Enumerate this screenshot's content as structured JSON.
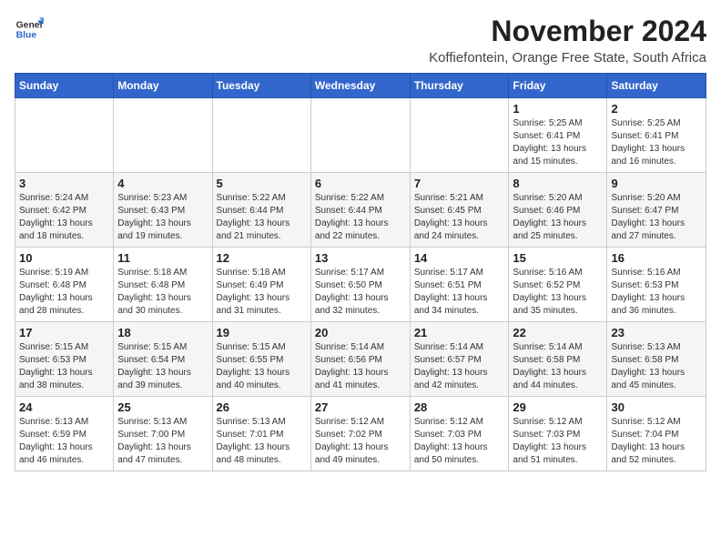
{
  "logo": {
    "line1": "General",
    "line2": "Blue"
  },
  "title": "November 2024",
  "subtitle": "Koffiefontein, Orange Free State, South Africa",
  "weekdays": [
    "Sunday",
    "Monday",
    "Tuesday",
    "Wednesday",
    "Thursday",
    "Friday",
    "Saturday"
  ],
  "weeks": [
    [
      {
        "day": "",
        "info": ""
      },
      {
        "day": "",
        "info": ""
      },
      {
        "day": "",
        "info": ""
      },
      {
        "day": "",
        "info": ""
      },
      {
        "day": "",
        "info": ""
      },
      {
        "day": "1",
        "info": "Sunrise: 5:25 AM\nSunset: 6:41 PM\nDaylight: 13 hours and 15 minutes."
      },
      {
        "day": "2",
        "info": "Sunrise: 5:25 AM\nSunset: 6:41 PM\nDaylight: 13 hours and 16 minutes."
      }
    ],
    [
      {
        "day": "3",
        "info": "Sunrise: 5:24 AM\nSunset: 6:42 PM\nDaylight: 13 hours and 18 minutes."
      },
      {
        "day": "4",
        "info": "Sunrise: 5:23 AM\nSunset: 6:43 PM\nDaylight: 13 hours and 19 minutes."
      },
      {
        "day": "5",
        "info": "Sunrise: 5:22 AM\nSunset: 6:44 PM\nDaylight: 13 hours and 21 minutes."
      },
      {
        "day": "6",
        "info": "Sunrise: 5:22 AM\nSunset: 6:44 PM\nDaylight: 13 hours and 22 minutes."
      },
      {
        "day": "7",
        "info": "Sunrise: 5:21 AM\nSunset: 6:45 PM\nDaylight: 13 hours and 24 minutes."
      },
      {
        "day": "8",
        "info": "Sunrise: 5:20 AM\nSunset: 6:46 PM\nDaylight: 13 hours and 25 minutes."
      },
      {
        "day": "9",
        "info": "Sunrise: 5:20 AM\nSunset: 6:47 PM\nDaylight: 13 hours and 27 minutes."
      }
    ],
    [
      {
        "day": "10",
        "info": "Sunrise: 5:19 AM\nSunset: 6:48 PM\nDaylight: 13 hours and 28 minutes."
      },
      {
        "day": "11",
        "info": "Sunrise: 5:18 AM\nSunset: 6:48 PM\nDaylight: 13 hours and 30 minutes."
      },
      {
        "day": "12",
        "info": "Sunrise: 5:18 AM\nSunset: 6:49 PM\nDaylight: 13 hours and 31 minutes."
      },
      {
        "day": "13",
        "info": "Sunrise: 5:17 AM\nSunset: 6:50 PM\nDaylight: 13 hours and 32 minutes."
      },
      {
        "day": "14",
        "info": "Sunrise: 5:17 AM\nSunset: 6:51 PM\nDaylight: 13 hours and 34 minutes."
      },
      {
        "day": "15",
        "info": "Sunrise: 5:16 AM\nSunset: 6:52 PM\nDaylight: 13 hours and 35 minutes."
      },
      {
        "day": "16",
        "info": "Sunrise: 5:16 AM\nSunset: 6:53 PM\nDaylight: 13 hours and 36 minutes."
      }
    ],
    [
      {
        "day": "17",
        "info": "Sunrise: 5:15 AM\nSunset: 6:53 PM\nDaylight: 13 hours and 38 minutes."
      },
      {
        "day": "18",
        "info": "Sunrise: 5:15 AM\nSunset: 6:54 PM\nDaylight: 13 hours and 39 minutes."
      },
      {
        "day": "19",
        "info": "Sunrise: 5:15 AM\nSunset: 6:55 PM\nDaylight: 13 hours and 40 minutes."
      },
      {
        "day": "20",
        "info": "Sunrise: 5:14 AM\nSunset: 6:56 PM\nDaylight: 13 hours and 41 minutes."
      },
      {
        "day": "21",
        "info": "Sunrise: 5:14 AM\nSunset: 6:57 PM\nDaylight: 13 hours and 42 minutes."
      },
      {
        "day": "22",
        "info": "Sunrise: 5:14 AM\nSunset: 6:58 PM\nDaylight: 13 hours and 44 minutes."
      },
      {
        "day": "23",
        "info": "Sunrise: 5:13 AM\nSunset: 6:58 PM\nDaylight: 13 hours and 45 minutes."
      }
    ],
    [
      {
        "day": "24",
        "info": "Sunrise: 5:13 AM\nSunset: 6:59 PM\nDaylight: 13 hours and 46 minutes."
      },
      {
        "day": "25",
        "info": "Sunrise: 5:13 AM\nSunset: 7:00 PM\nDaylight: 13 hours and 47 minutes."
      },
      {
        "day": "26",
        "info": "Sunrise: 5:13 AM\nSunset: 7:01 PM\nDaylight: 13 hours and 48 minutes."
      },
      {
        "day": "27",
        "info": "Sunrise: 5:12 AM\nSunset: 7:02 PM\nDaylight: 13 hours and 49 minutes."
      },
      {
        "day": "28",
        "info": "Sunrise: 5:12 AM\nSunset: 7:03 PM\nDaylight: 13 hours and 50 minutes."
      },
      {
        "day": "29",
        "info": "Sunrise: 5:12 AM\nSunset: 7:03 PM\nDaylight: 13 hours and 51 minutes."
      },
      {
        "day": "30",
        "info": "Sunrise: 5:12 AM\nSunset: 7:04 PM\nDaylight: 13 hours and 52 minutes."
      }
    ]
  ]
}
